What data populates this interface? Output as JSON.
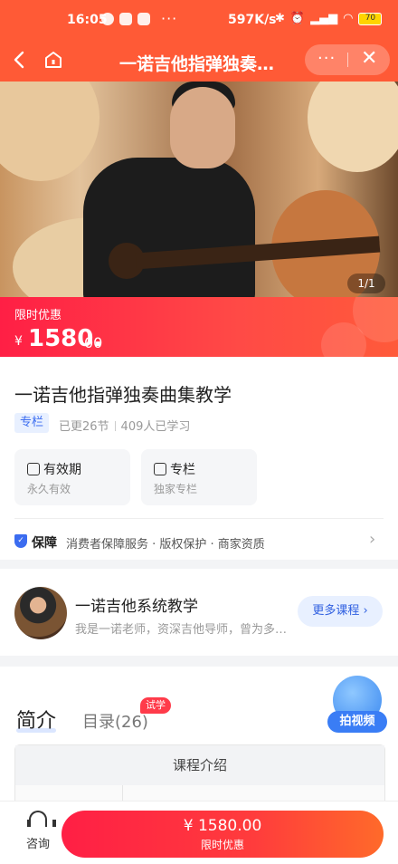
{
  "status_bar": {
    "time": "16:05",
    "dots": "···",
    "net_speed": "597K/s",
    "battery": "70"
  },
  "nav": {
    "title": "一诺吉他指弹独奏…",
    "back_icon": "chevron-left-icon",
    "home_icon": "home-icon",
    "more_label": "···",
    "close_label": "✕"
  },
  "hero": {
    "pager": "1/1"
  },
  "price": {
    "tag": "限时优惠",
    "currency": "¥",
    "amount": "1580.",
    "decimals": "00"
  },
  "course": {
    "title": "一诺吉他指弹独奏曲集教学",
    "badge": "专栏",
    "updated": "已更26节",
    "learners": "409人已学习"
  },
  "cards": [
    {
      "title": "有效期",
      "sub": "永久有效",
      "icon": "calendar-icon"
    },
    {
      "title": "专栏",
      "sub": "独家专栏",
      "icon": "bookmark-icon"
    }
  ],
  "guarantee": {
    "title": "保障",
    "items": "消费者保障服务 · 版权保护 · 商家资质"
  },
  "teacher": {
    "name": "一诺吉他系统教学",
    "desc": "我是一诺老师，资深吉他导师，曾为多…",
    "more_button": "更多课程"
  },
  "tabs": {
    "intro": "简介",
    "toc": "目录(26)",
    "trial_badge": "试学"
  },
  "float_button": {
    "label": "拍视频"
  },
  "intro_table": {
    "header": "课程介绍"
  },
  "bottom": {
    "consult": "咨询",
    "buy_price": "¥ 1580.00",
    "buy_sub": "限时优惠"
  },
  "colors": {
    "primary": "#ff5a36",
    "price_red": "#ff1f45",
    "accent_blue": "#3b6cf0"
  }
}
